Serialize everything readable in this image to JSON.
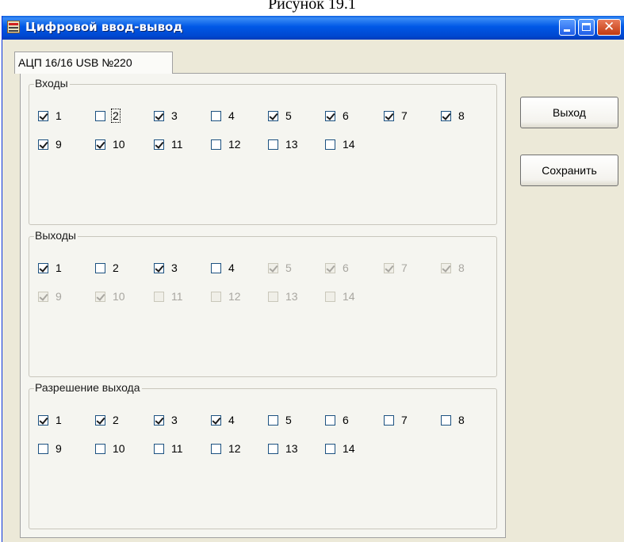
{
  "caption": "Рисунок 19.1",
  "window": {
    "title": "Цифровой ввод-вывод",
    "accent": "#0058e6"
  },
  "tab": {
    "label": "АЦП 16/16 USB №220"
  },
  "buttons": {
    "exit": "Выход",
    "save": "Сохранить"
  },
  "groups": [
    {
      "title": "Входы",
      "items": [
        {
          "label": "1",
          "checked": true,
          "enabled": true
        },
        {
          "label": "2",
          "checked": false,
          "enabled": true,
          "focused": true
        },
        {
          "label": "3",
          "checked": true,
          "enabled": true
        },
        {
          "label": "4",
          "checked": false,
          "enabled": true
        },
        {
          "label": "5",
          "checked": true,
          "enabled": true
        },
        {
          "label": "6",
          "checked": true,
          "enabled": true
        },
        {
          "label": "7",
          "checked": true,
          "enabled": true
        },
        {
          "label": "8",
          "checked": true,
          "enabled": true
        },
        {
          "label": "9",
          "checked": true,
          "enabled": true
        },
        {
          "label": "10",
          "checked": true,
          "enabled": true
        },
        {
          "label": "11",
          "checked": true,
          "enabled": true
        },
        {
          "label": "12",
          "checked": false,
          "enabled": true
        },
        {
          "label": "13",
          "checked": false,
          "enabled": true
        },
        {
          "label": "14",
          "checked": false,
          "enabled": true
        }
      ]
    },
    {
      "title": "Выходы",
      "items": [
        {
          "label": "1",
          "checked": true,
          "enabled": true
        },
        {
          "label": "2",
          "checked": false,
          "enabled": true
        },
        {
          "label": "3",
          "checked": true,
          "enabled": true
        },
        {
          "label": "4",
          "checked": false,
          "enabled": true
        },
        {
          "label": "5",
          "checked": true,
          "enabled": false
        },
        {
          "label": "6",
          "checked": true,
          "enabled": false
        },
        {
          "label": "7",
          "checked": true,
          "enabled": false
        },
        {
          "label": "8",
          "checked": true,
          "enabled": false
        },
        {
          "label": "9",
          "checked": true,
          "enabled": false
        },
        {
          "label": "10",
          "checked": true,
          "enabled": false
        },
        {
          "label": "11",
          "checked": false,
          "enabled": false
        },
        {
          "label": "12",
          "checked": false,
          "enabled": false
        },
        {
          "label": "13",
          "checked": false,
          "enabled": false
        },
        {
          "label": "14",
          "checked": false,
          "enabled": false
        }
      ]
    },
    {
      "title": "Разрешение выхода",
      "items": [
        {
          "label": "1",
          "checked": true,
          "enabled": true
        },
        {
          "label": "2",
          "checked": true,
          "enabled": true
        },
        {
          "label": "3",
          "checked": true,
          "enabled": true
        },
        {
          "label": "4",
          "checked": true,
          "enabled": true
        },
        {
          "label": "5",
          "checked": false,
          "enabled": true
        },
        {
          "label": "6",
          "checked": false,
          "enabled": true
        },
        {
          "label": "7",
          "checked": false,
          "enabled": true
        },
        {
          "label": "8",
          "checked": false,
          "enabled": true
        },
        {
          "label": "9",
          "checked": false,
          "enabled": true
        },
        {
          "label": "10",
          "checked": false,
          "enabled": true
        },
        {
          "label": "11",
          "checked": false,
          "enabled": true
        },
        {
          "label": "12",
          "checked": false,
          "enabled": true
        },
        {
          "label": "13",
          "checked": false,
          "enabled": true
        },
        {
          "label": "14",
          "checked": false,
          "enabled": true
        }
      ]
    }
  ]
}
